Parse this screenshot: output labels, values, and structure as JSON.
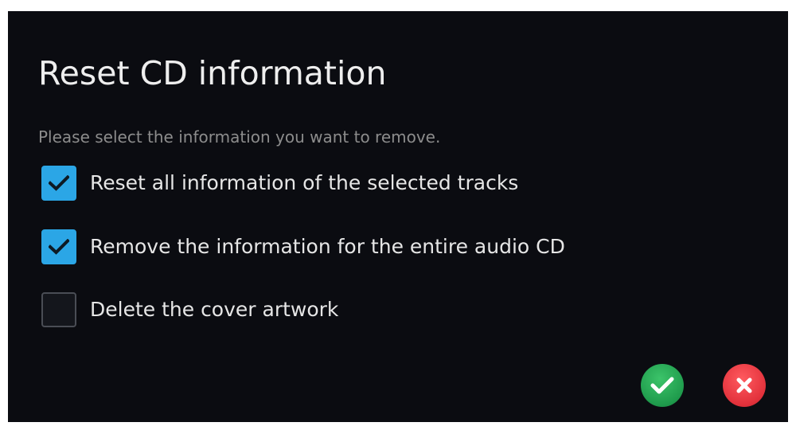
{
  "dialog": {
    "title": "Reset CD information",
    "prompt": "Please select the information you want to remove."
  },
  "options": [
    {
      "label": "Reset all information of the selected tracks",
      "checked": true
    },
    {
      "label": "Remove the information for the entire audio CD",
      "checked": true
    },
    {
      "label": "Delete the cover artwork",
      "checked": false
    }
  ],
  "buttons": {
    "confirm_icon": "check-icon",
    "cancel_icon": "close-icon"
  },
  "colors": {
    "background": "#0b0c11",
    "checkbox_checked": "#2ba6e6",
    "confirm": "#1f9b4c",
    "cancel": "#e2313b"
  }
}
